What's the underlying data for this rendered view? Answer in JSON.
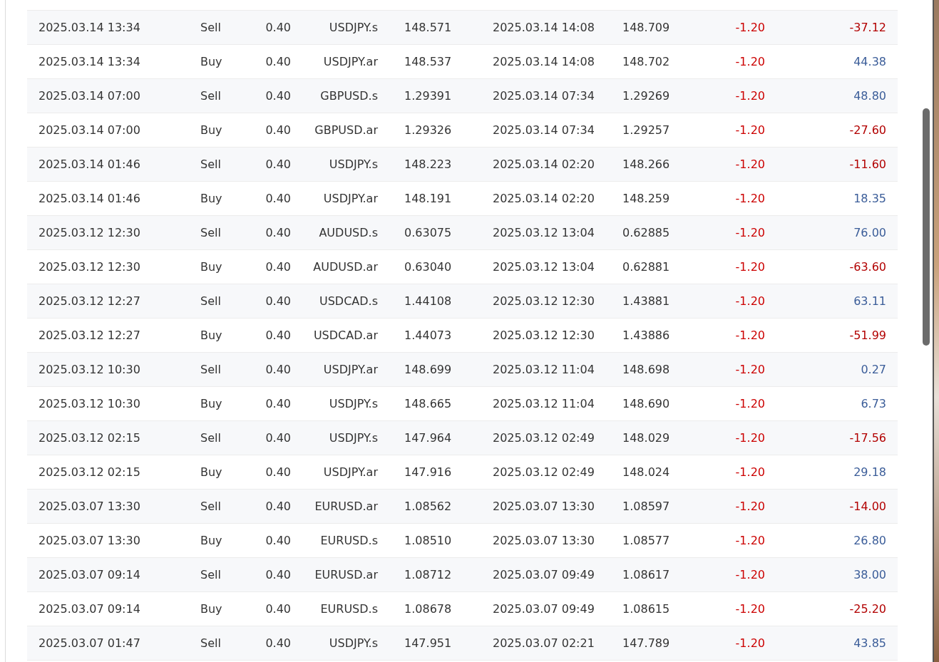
{
  "trades": [
    {
      "open_time": "2025.03.14 13:34",
      "type": "Sell",
      "volume": "0.40",
      "symbol": "USDJPY.s",
      "open_price": "148.571",
      "close_time": "2025.03.14 14:08",
      "close_price": "148.709",
      "commission": "-1.20",
      "profit": "-37.12",
      "loss": true
    },
    {
      "open_time": "2025.03.14 13:34",
      "type": "Buy",
      "volume": "0.40",
      "symbol": "USDJPY.ar",
      "open_price": "148.537",
      "close_time": "2025.03.14 14:08",
      "close_price": "148.702",
      "commission": "-1.20",
      "profit": "44.38",
      "loss": false
    },
    {
      "open_time": "2025.03.14 07:00",
      "type": "Sell",
      "volume": "0.40",
      "symbol": "GBPUSD.s",
      "open_price": "1.29391",
      "close_time": "2025.03.14 07:34",
      "close_price": "1.29269",
      "commission": "-1.20",
      "profit": "48.80",
      "loss": false
    },
    {
      "open_time": "2025.03.14 07:00",
      "type": "Buy",
      "volume": "0.40",
      "symbol": "GBPUSD.ar",
      "open_price": "1.29326",
      "close_time": "2025.03.14 07:34",
      "close_price": "1.29257",
      "commission": "-1.20",
      "profit": "-27.60",
      "loss": true
    },
    {
      "open_time": "2025.03.14 01:46",
      "type": "Sell",
      "volume": "0.40",
      "symbol": "USDJPY.s",
      "open_price": "148.223",
      "close_time": "2025.03.14 02:20",
      "close_price": "148.266",
      "commission": "-1.20",
      "profit": "-11.60",
      "loss": true
    },
    {
      "open_time": "2025.03.14 01:46",
      "type": "Buy",
      "volume": "0.40",
      "symbol": "USDJPY.ar",
      "open_price": "148.191",
      "close_time": "2025.03.14 02:20",
      "close_price": "148.259",
      "commission": "-1.20",
      "profit": "18.35",
      "loss": false
    },
    {
      "open_time": "2025.03.12 12:30",
      "type": "Sell",
      "volume": "0.40",
      "symbol": "AUDUSD.s",
      "open_price": "0.63075",
      "close_time": "2025.03.12 13:04",
      "close_price": "0.62885",
      "commission": "-1.20",
      "profit": "76.00",
      "loss": false
    },
    {
      "open_time": "2025.03.12 12:30",
      "type": "Buy",
      "volume": "0.40",
      "symbol": "AUDUSD.ar",
      "open_price": "0.63040",
      "close_time": "2025.03.12 13:04",
      "close_price": "0.62881",
      "commission": "-1.20",
      "profit": "-63.60",
      "loss": true
    },
    {
      "open_time": "2025.03.12 12:27",
      "type": "Sell",
      "volume": "0.40",
      "symbol": "USDCAD.s",
      "open_price": "1.44108",
      "close_time": "2025.03.12 12:30",
      "close_price": "1.43881",
      "commission": "-1.20",
      "profit": "63.11",
      "loss": false
    },
    {
      "open_time": "2025.03.12 12:27",
      "type": "Buy",
      "volume": "0.40",
      "symbol": "USDCAD.ar",
      "open_price": "1.44073",
      "close_time": "2025.03.12 12:30",
      "close_price": "1.43886",
      "commission": "-1.20",
      "profit": "-51.99",
      "loss": true
    },
    {
      "open_time": "2025.03.12 10:30",
      "type": "Sell",
      "volume": "0.40",
      "symbol": "USDJPY.ar",
      "open_price": "148.699",
      "close_time": "2025.03.12 11:04",
      "close_price": "148.698",
      "commission": "-1.20",
      "profit": "0.27",
      "loss": false
    },
    {
      "open_time": "2025.03.12 10:30",
      "type": "Buy",
      "volume": "0.40",
      "symbol": "USDJPY.s",
      "open_price": "148.665",
      "close_time": "2025.03.12 11:04",
      "close_price": "148.690",
      "commission": "-1.20",
      "profit": "6.73",
      "loss": false
    },
    {
      "open_time": "2025.03.12 02:15",
      "type": "Sell",
      "volume": "0.40",
      "symbol": "USDJPY.s",
      "open_price": "147.964",
      "close_time": "2025.03.12 02:49",
      "close_price": "148.029",
      "commission": "-1.20",
      "profit": "-17.56",
      "loss": true
    },
    {
      "open_time": "2025.03.12 02:15",
      "type": "Buy",
      "volume": "0.40",
      "symbol": "USDJPY.ar",
      "open_price": "147.916",
      "close_time": "2025.03.12 02:49",
      "close_price": "148.024",
      "commission": "-1.20",
      "profit": "29.18",
      "loss": false
    },
    {
      "open_time": "2025.03.07 13:30",
      "type": "Sell",
      "volume": "0.40",
      "symbol": "EURUSD.ar",
      "open_price": "1.08562",
      "close_time": "2025.03.07 13:30",
      "close_price": "1.08597",
      "commission": "-1.20",
      "profit": "-14.00",
      "loss": true
    },
    {
      "open_time": "2025.03.07 13:30",
      "type": "Buy",
      "volume": "0.40",
      "symbol": "EURUSD.s",
      "open_price": "1.08510",
      "close_time": "2025.03.07 13:30",
      "close_price": "1.08577",
      "commission": "-1.20",
      "profit": "26.80",
      "loss": false
    },
    {
      "open_time": "2025.03.07 09:14",
      "type": "Sell",
      "volume": "0.40",
      "symbol": "EURUSD.ar",
      "open_price": "1.08712",
      "close_time": "2025.03.07 09:49",
      "close_price": "1.08617",
      "commission": "-1.20",
      "profit": "38.00",
      "loss": false
    },
    {
      "open_time": "2025.03.07 09:14",
      "type": "Buy",
      "volume": "0.40",
      "symbol": "EURUSD.s",
      "open_price": "1.08678",
      "close_time": "2025.03.07 09:49",
      "close_price": "1.08615",
      "commission": "-1.20",
      "profit": "-25.20",
      "loss": true
    },
    {
      "open_time": "2025.03.07 01:47",
      "type": "Sell",
      "volume": "0.40",
      "symbol": "USDJPY.s",
      "open_price": "147.951",
      "close_time": "2025.03.07 02:21",
      "close_price": "147.789",
      "commission": "-1.20",
      "profit": "43.85",
      "loss": false
    }
  ]
}
